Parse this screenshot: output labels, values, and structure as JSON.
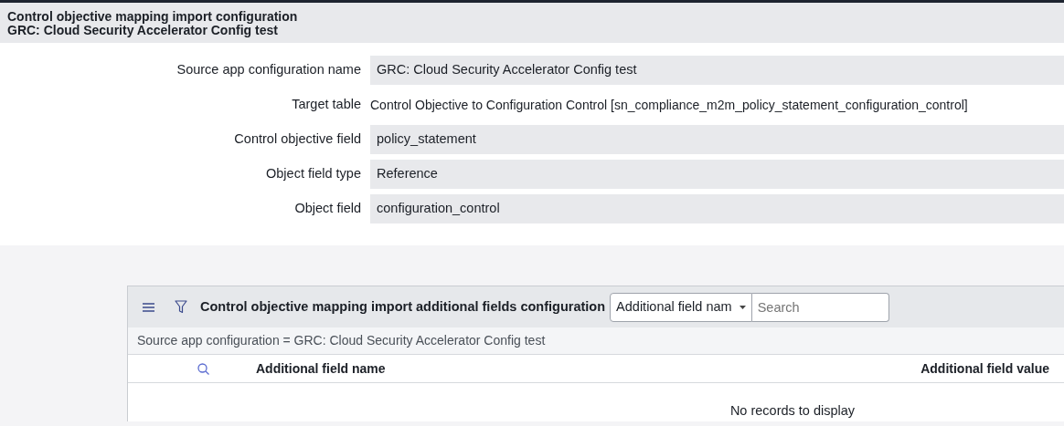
{
  "header": {
    "title": "Control objective mapping import configuration",
    "subtitle": "GRC: Cloud Security Accelerator Config test"
  },
  "form_fields": [
    {
      "label": "Source app configuration name",
      "kind": "field",
      "value": "GRC: Cloud Security Accelerator Config test"
    },
    {
      "label": "Target table",
      "kind": "text",
      "value": "Control Objective to Configuration Control [sn_compliance_m2m_policy_statement_configuration_control]"
    },
    {
      "label": "Control objective field",
      "kind": "field",
      "value": "policy_statement"
    },
    {
      "label": "Object field type",
      "kind": "field",
      "value": "Reference"
    },
    {
      "label": "Object field",
      "kind": "field",
      "value": "configuration_control"
    }
  ],
  "related_list": {
    "title": "Control objective mapping import additional fields configuration",
    "search_column": "Additional field nam",
    "search": {
      "placeholder": "Search"
    },
    "breadcrumb": "Source app configuration = GRC: Cloud Security Accelerator Config test",
    "columns": [
      "Additional field name",
      "Additional field value"
    ],
    "empty_message": "No records to display"
  }
}
